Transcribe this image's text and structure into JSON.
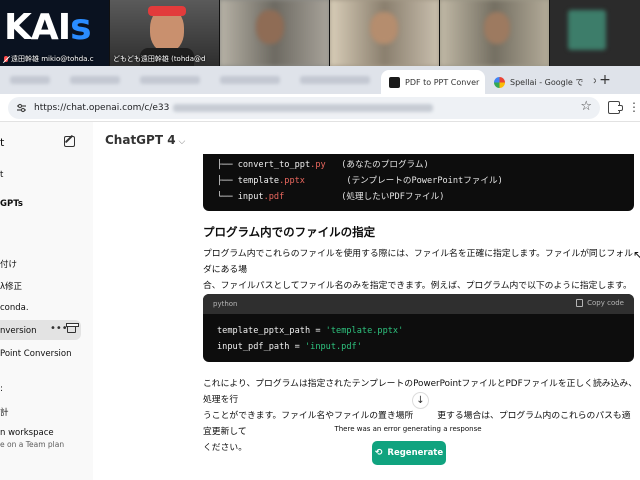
{
  "video_call": {
    "tiles": [
      {
        "name": "遠田幹雄 mikio@tohda.c",
        "logo": "KAIs"
      },
      {
        "name": "どもども遠田幹雄 (tohda@d"
      },
      {
        "name": ""
      },
      {
        "name": ""
      },
      {
        "name": ""
      },
      {
        "name": ""
      }
    ]
  },
  "browser": {
    "tabs": [
      {
        "label": "PDF to PPT Conver",
        "active": true
      },
      {
        "label": "Spellai - Google で",
        "active": false
      }
    ],
    "url": "https://chat.openai.com/c/e33"
  },
  "sidebar": {
    "items": [
      {
        "label": "t"
      },
      {
        "label": "GPTs"
      },
      {
        "label": "付け"
      },
      {
        "label": "λ修正"
      },
      {
        "label": "conda."
      },
      {
        "label": "nversion"
      },
      {
        "label": "Point Conversion"
      },
      {
        "label": "計"
      },
      {
        "label": "n workspace"
      },
      {
        "label": "e on a Team plan"
      }
    ]
  },
  "main": {
    "model": "ChatGPT 4",
    "tree_lines": [
      {
        "prefix": "├── ",
        "name": "convert_to_ppt",
        "ext": ".py",
        "comment": "(あなたのプログラム)"
      },
      {
        "prefix": "├── ",
        "name": "template",
        "ext": ".pptx",
        "comment": "(テンプレートのPowerPointファイル)"
      },
      {
        "prefix": "└── ",
        "name": "input",
        "ext": ".pdf",
        "comment": "(処理したいPDFファイル)"
      }
    ],
    "heading": "プログラム内でのファイルの指定",
    "para1_line1": "プログラム内でこれらのファイルを使用する際には、ファイル名を正確に指定します。ファイルが同じフォルダにある場",
    "para1_line2": "合、ファイルパスとしてファイル名のみを指定できます。例えば、プログラム内で以下のように指定します。",
    "code": {
      "lang": "python",
      "copy_label": "Copy code",
      "lines": [
        {
          "var": "template_pptx_path",
          "op": " = ",
          "str": "'template.pptx'"
        },
        {
          "var": "input_pdf_path",
          "op": " = ",
          "str": "'input.pdf'"
        }
      ]
    },
    "para2_line1": "これにより、プログラムは指定されたテンプレートのPowerPointファイルとPDFファイルを正しく読み込み、処理を行",
    "para2_line2a": "うことができます。ファイル名やファイルの置き場所",
    "para2_line2b": "更する場合は、プログラム内のこれらのパスも適宜更新して",
    "para2_line3": "ください。",
    "error": "There was an error generating a response",
    "regenerate": "Regenerate"
  }
}
